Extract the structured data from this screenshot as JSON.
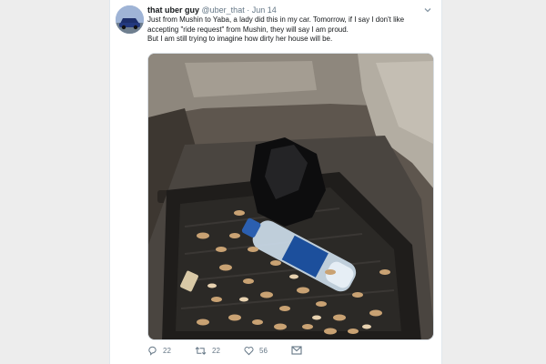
{
  "tweet": {
    "author_name": "that uber guy",
    "author_handle": "@uber_that",
    "separator": "·",
    "date": "Jun 14",
    "text_lines": [
      "Just from Mushin to Yaba, a lady did this in my car. Tomorrow, if I say I don't like",
      "accepting \"ride request\" from Mushin, they will say I am proud.",
      "But I am still trying to imagine how dirty her house will be."
    ]
  },
  "actions": {
    "replies": "22",
    "retweets": "22",
    "likes": "56"
  },
  "icons": {
    "avatar": "car-avatar",
    "caret": "chevron-down-icon",
    "reply": "reply-icon",
    "retweet": "retweet-icon",
    "like": "heart-icon",
    "message": "envelope-icon"
  },
  "colors": {
    "text": "#14171a",
    "secondary": "#657786",
    "border": "#e1e8ed"
  }
}
